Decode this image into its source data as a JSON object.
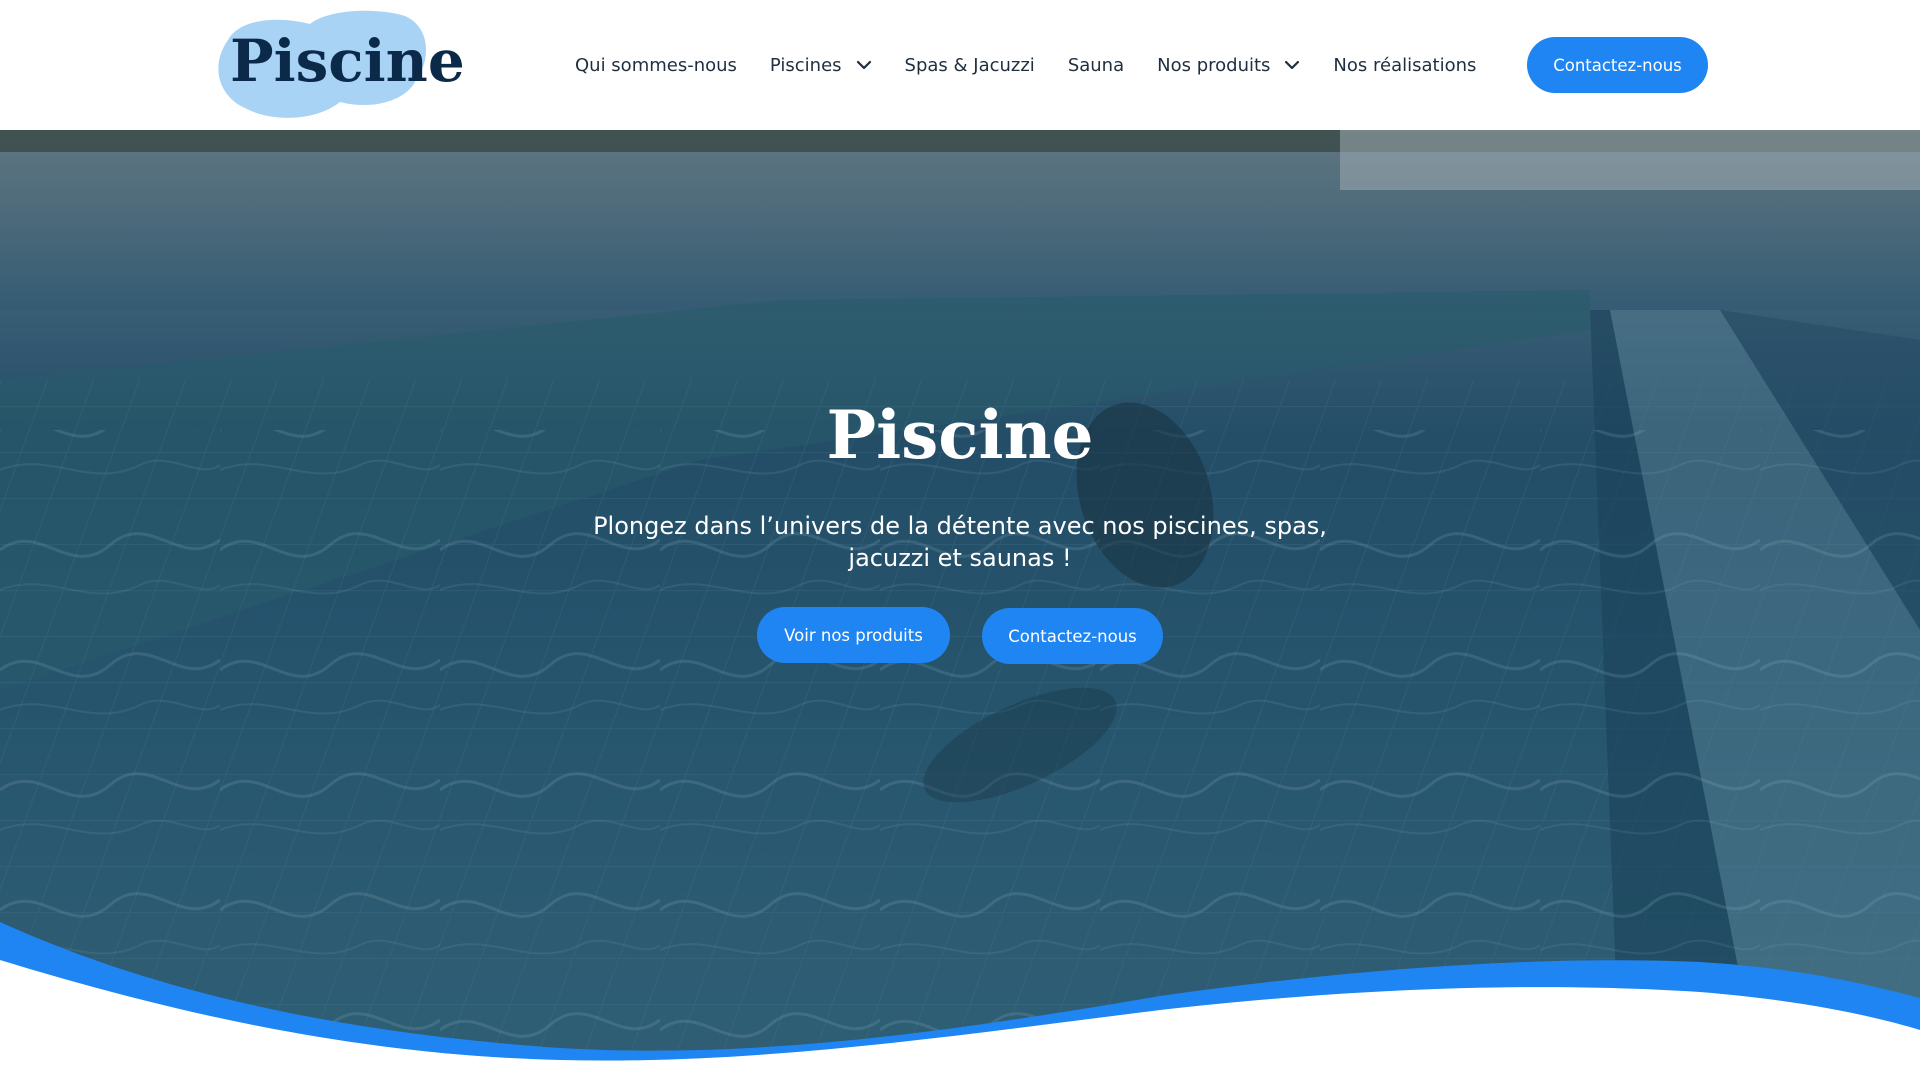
{
  "colors": {
    "brand_blue": "#1f85f2",
    "logo_blob": "#a9d3f5",
    "logo_text": "#0b2a4a",
    "nav_text": "#1f2f3f",
    "hero_water": "#2f5f7d"
  },
  "header": {
    "logo_text": "Piscine",
    "nav": [
      {
        "label": "Qui sommes-nous",
        "dropdown": false
      },
      {
        "label": "Piscines",
        "dropdown": true
      },
      {
        "label": "Spas & Jacuzzi",
        "dropdown": false
      },
      {
        "label": "Sauna",
        "dropdown": false
      },
      {
        "label": "Nos produits",
        "dropdown": true
      },
      {
        "label": "Nos réalisations",
        "dropdown": false
      }
    ],
    "cta_label": "Contactez-nous"
  },
  "hero": {
    "title": "Piscine",
    "subtitle": "Plongez dans l’univers de la détente avec nos piscines, spas, jacuzzi et saunas !",
    "primary_button": "Voir nos produits",
    "secondary_button": "Contactez-nous",
    "background": "underwater swimming pool photo"
  }
}
